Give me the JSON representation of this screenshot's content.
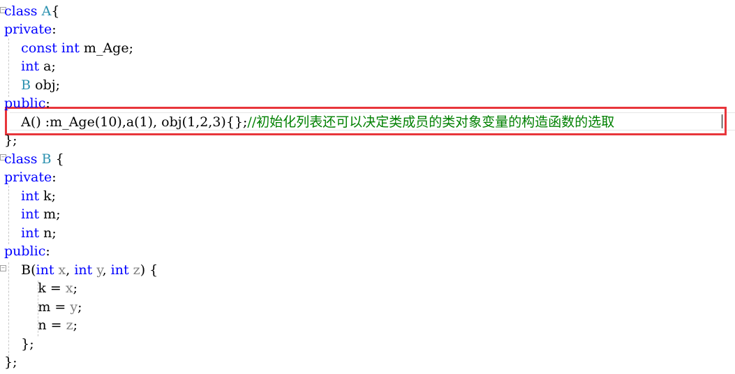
{
  "editor": {
    "lines": [
      {
        "tokens": [
          {
            "t": "class ",
            "c": "kw"
          },
          {
            "t": "A",
            "c": "type"
          },
          {
            "t": "{",
            "c": "plain"
          }
        ]
      },
      {
        "tokens": [
          {
            "t": "private",
            "c": "kw"
          },
          {
            "t": ":",
            "c": "plain"
          }
        ]
      },
      {
        "tokens": [
          {
            "t": "    ",
            "c": "plain"
          },
          {
            "t": "const ",
            "c": "kw"
          },
          {
            "t": "int ",
            "c": "kw"
          },
          {
            "t": "m_Age;",
            "c": "plain"
          }
        ]
      },
      {
        "tokens": [
          {
            "t": "    ",
            "c": "plain"
          },
          {
            "t": "int ",
            "c": "kw"
          },
          {
            "t": "a;",
            "c": "plain"
          }
        ]
      },
      {
        "tokens": [
          {
            "t": "    ",
            "c": "plain"
          },
          {
            "t": "B",
            "c": "type"
          },
          {
            "t": " obj;",
            "c": "plain"
          }
        ]
      },
      {
        "tokens": [
          {
            "t": "public",
            "c": "kw"
          },
          {
            "t": ":",
            "c": "plain"
          }
        ]
      },
      {
        "tokens": [
          {
            "t": "    ",
            "c": "plain"
          },
          {
            "t": "A",
            "c": "plain"
          },
          {
            "t": "() :m_Age(10),a(1), obj(1,2,3){};",
            "c": "plain"
          },
          {
            "t": "//初始化列表还可以决定类成员的类对象变量的构造函数的选取",
            "c": "cm"
          }
        ]
      },
      {
        "tokens": [
          {
            "t": "};",
            "c": "plain"
          }
        ]
      },
      {
        "tokens": [
          {
            "t": "class ",
            "c": "kw"
          },
          {
            "t": "B",
            "c": "type"
          },
          {
            "t": " {",
            "c": "plain"
          }
        ]
      },
      {
        "tokens": [
          {
            "t": "private",
            "c": "kw"
          },
          {
            "t": ":",
            "c": "plain"
          }
        ]
      },
      {
        "tokens": [
          {
            "t": "    ",
            "c": "plain"
          },
          {
            "t": "int ",
            "c": "kw"
          },
          {
            "t": "k;",
            "c": "plain"
          }
        ]
      },
      {
        "tokens": [
          {
            "t": "    ",
            "c": "plain"
          },
          {
            "t": "int ",
            "c": "kw"
          },
          {
            "t": "m;",
            "c": "plain"
          }
        ]
      },
      {
        "tokens": [
          {
            "t": "    ",
            "c": "plain"
          },
          {
            "t": "int ",
            "c": "kw"
          },
          {
            "t": "n;",
            "c": "plain"
          }
        ]
      },
      {
        "tokens": [
          {
            "t": "public",
            "c": "kw"
          },
          {
            "t": ":",
            "c": "plain"
          }
        ]
      },
      {
        "tokens": [
          {
            "t": "    ",
            "c": "plain"
          },
          {
            "t": "B(",
            "c": "plain"
          },
          {
            "t": "int ",
            "c": "kw"
          },
          {
            "t": "x",
            "c": "param"
          },
          {
            "t": ", ",
            "c": "plain"
          },
          {
            "t": "int ",
            "c": "kw"
          },
          {
            "t": "y",
            "c": "param"
          },
          {
            "t": ", ",
            "c": "plain"
          },
          {
            "t": "int ",
            "c": "kw"
          },
          {
            "t": "z",
            "c": "param"
          },
          {
            "t": ") {",
            "c": "plain"
          }
        ]
      },
      {
        "tokens": [
          {
            "t": "        ",
            "c": "plain"
          },
          {
            "t": "k = ",
            "c": "plain"
          },
          {
            "t": "x",
            "c": "param"
          },
          {
            "t": ";",
            "c": "plain"
          }
        ]
      },
      {
        "tokens": [
          {
            "t": "        ",
            "c": "plain"
          },
          {
            "t": "m = ",
            "c": "plain"
          },
          {
            "t": "y",
            "c": "param"
          },
          {
            "t": ";",
            "c": "plain"
          }
        ]
      },
      {
        "tokens": [
          {
            "t": "        ",
            "c": "plain"
          },
          {
            "t": "n = ",
            "c": "plain"
          },
          {
            "t": "z",
            "c": "param"
          },
          {
            "t": ";",
            "c": "plain"
          }
        ]
      },
      {
        "tokens": [
          {
            "t": "    ",
            "c": "plain"
          },
          {
            "t": "};",
            "c": "plain"
          }
        ]
      },
      {
        "tokens": [
          {
            "t": "};",
            "c": "plain"
          }
        ]
      }
    ],
    "fold_glyph": "⊟",
    "colors": {
      "keyword": "#0000ff",
      "type": "#2b91af",
      "comment": "#008000",
      "parameter": "#808080",
      "highlight_border": "#e8353b"
    }
  }
}
